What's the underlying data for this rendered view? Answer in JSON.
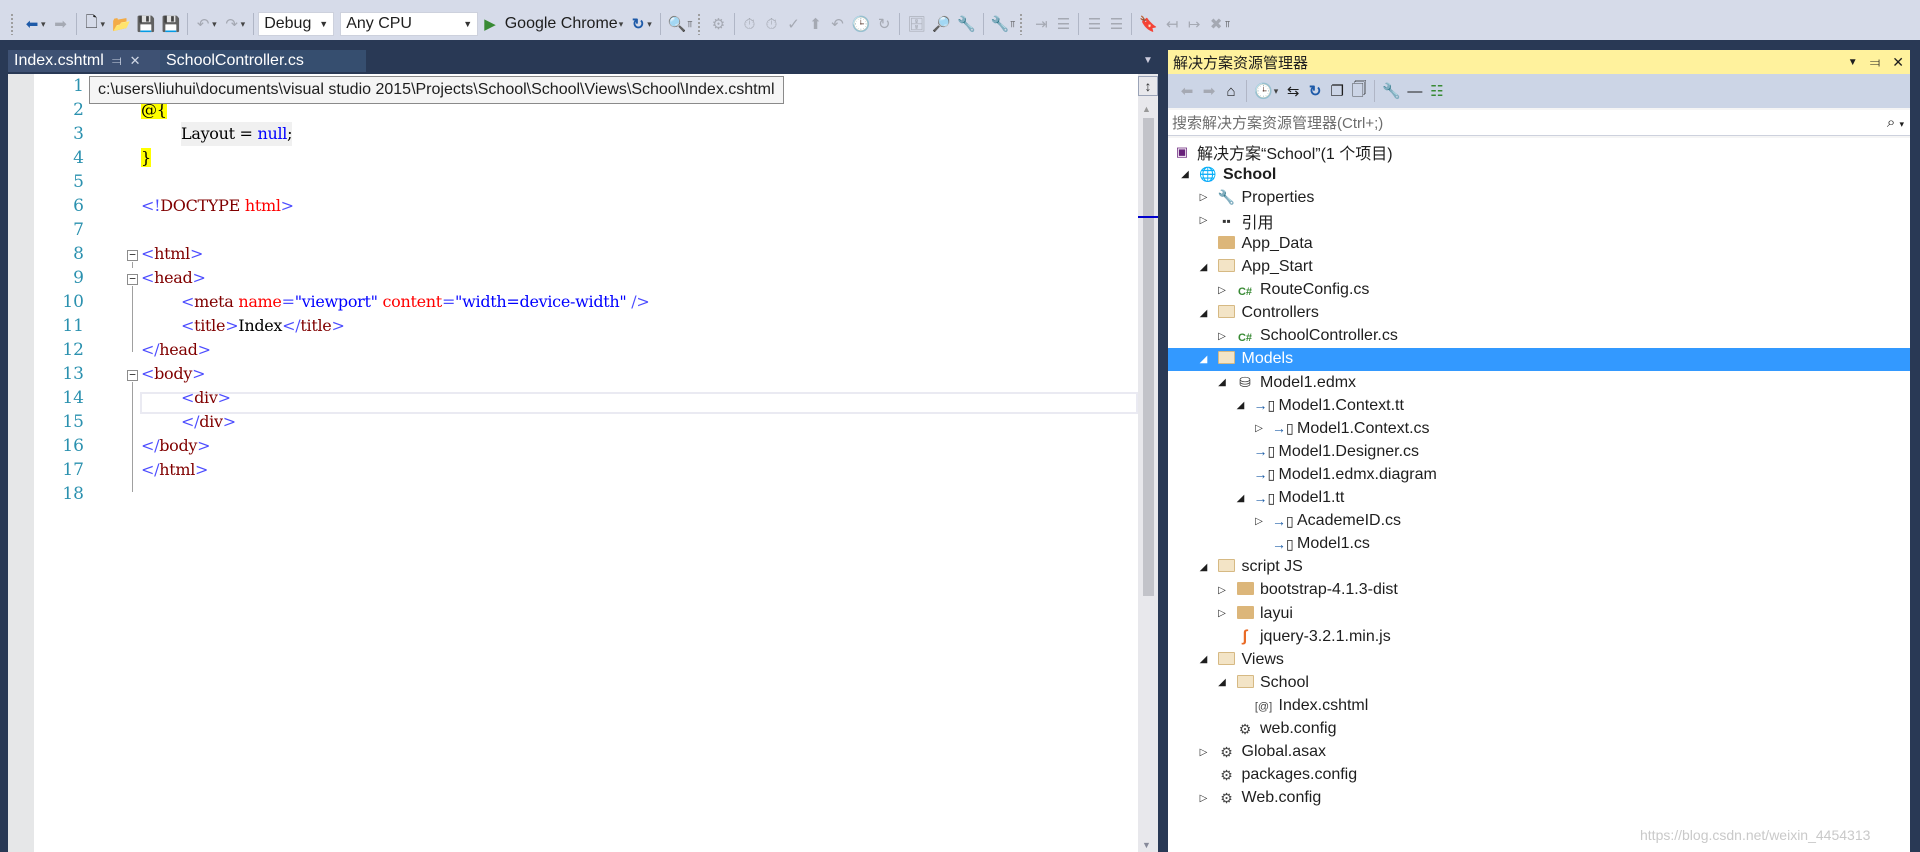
{
  "toolbar": {
    "configuration": "Debug",
    "platform": "Any CPU",
    "run_target": "Google Chrome",
    "icons": [
      "back-icon",
      "forward-icon",
      "new-project-icon",
      "open-file-icon",
      "save-icon",
      "save-all-icon",
      "undo-icon",
      "redo-icon",
      "refresh-icon",
      "find-in-files-icon",
      "bookmark-icon",
      "prev-bookmark-icon",
      "next-bookmark-icon",
      "clear-bookmarks-icon"
    ]
  },
  "tabs": [
    {
      "label": "Index.cshtml",
      "active": true
    },
    {
      "label": "SchoolController.cs",
      "active": false
    }
  ],
  "editor": {
    "tooltip_path": "c:\\users\\liuhui\\documents\\visual studio 2015\\Projects\\School\\School\\Views\\School\\Index.cshtml",
    "line_numbers": [
      "1",
      "2",
      "3",
      "4",
      "5",
      "6",
      "7",
      "8",
      "9",
      "10",
      "11",
      "12",
      "13",
      "14",
      "15",
      "16",
      "17",
      "18"
    ],
    "code": {
      "l2_at": "@{",
      "l3_layout": "Layout = ",
      "l3_null": "null",
      "l3_semi": ";",
      "l4_close": "}",
      "l6_lt": "<!",
      "l6_doctype": "DOCTYPE",
      "l6_html": " html",
      "l6_gt": ">",
      "html_tag": "html",
      "head_tag": "head",
      "meta_tag": "meta",
      "name_attr": " name",
      "eq": "=",
      "viewport_val": "\"viewport\"",
      "content_attr": " content",
      "content_val": "\"width=device-width\"",
      "self_close": " />",
      "title_tag": "title",
      "title_text": "Index",
      "body_tag": "body",
      "div_tag": "div",
      "lt": "<",
      "lt_slash": "</",
      "gt": ">"
    }
  },
  "solution_explorer": {
    "title": "解决方案资源管理器",
    "search_placeholder": "搜索解决方案资源管理器(Ctrl+;)",
    "tree": [
      {
        "label": "解决方案“School”(1 个项目)",
        "depth": 0,
        "expander": "",
        "icon": "solution-icon"
      },
      {
        "label": "School",
        "depth": 0,
        "expander": "expanded",
        "icon": "web-project-icon",
        "bold": true
      },
      {
        "label": "Properties",
        "depth": 1,
        "expander": "collapsed",
        "icon": "wrench-icon"
      },
      {
        "label": "引用",
        "depth": 1,
        "expander": "collapsed",
        "icon": "references-icon"
      },
      {
        "label": "App_Data",
        "depth": 1,
        "expander": "",
        "icon": "folder-icon"
      },
      {
        "label": "App_Start",
        "depth": 1,
        "expander": "expanded",
        "icon": "folder-open-icon"
      },
      {
        "label": "RouteConfig.cs",
        "depth": 2,
        "expander": "collapsed",
        "icon": "csharp-file-icon"
      },
      {
        "label": "Controllers",
        "depth": 1,
        "expander": "expanded",
        "icon": "folder-open-icon"
      },
      {
        "label": "SchoolController.cs",
        "depth": 2,
        "expander": "collapsed",
        "icon": "csharp-file-icon"
      },
      {
        "label": "Models",
        "depth": 1,
        "expander": "expanded",
        "icon": "folder-open-icon",
        "selected": true
      },
      {
        "label": "Model1.edmx",
        "depth": 2,
        "expander": "expanded",
        "icon": "edmx-icon"
      },
      {
        "label": "Model1.Context.tt",
        "depth": 3,
        "expander": "expanded",
        "icon": "template-file-icon"
      },
      {
        "label": "Model1.Context.cs",
        "depth": 4,
        "expander": "collapsed",
        "icon": "template-file-icon"
      },
      {
        "label": "Model1.Designer.cs",
        "depth": 3,
        "expander": "",
        "icon": "template-file-icon"
      },
      {
        "label": "Model1.edmx.diagram",
        "depth": 3,
        "expander": "",
        "icon": "template-file-icon"
      },
      {
        "label": "Model1.tt",
        "depth": 3,
        "expander": "expanded",
        "icon": "template-file-icon"
      },
      {
        "label": "AcademeID.cs",
        "depth": 4,
        "expander": "collapsed",
        "icon": "template-file-icon"
      },
      {
        "label": "Model1.cs",
        "depth": 4,
        "expander": "",
        "icon": "template-file-icon"
      },
      {
        "label": "script JS",
        "depth": 1,
        "expander": "expanded",
        "icon": "folder-open-icon"
      },
      {
        "label": "bootstrap-4.1.3-dist",
        "depth": 2,
        "expander": "collapsed",
        "icon": "folder-icon"
      },
      {
        "label": "layui",
        "depth": 2,
        "expander": "collapsed",
        "icon": "folder-icon"
      },
      {
        "label": "jquery-3.2.1.min.js",
        "depth": 2,
        "expander": "",
        "icon": "js-file-icon"
      },
      {
        "label": "Views",
        "depth": 1,
        "expander": "expanded",
        "icon": "folder-open-icon"
      },
      {
        "label": "School",
        "depth": 2,
        "expander": "expanded",
        "icon": "folder-open-icon"
      },
      {
        "label": "Index.cshtml",
        "depth": 3,
        "expander": "",
        "icon": "razor-file-icon"
      },
      {
        "label": "web.config",
        "depth": 2,
        "expander": "",
        "icon": "config-file-icon"
      },
      {
        "label": "Global.asax",
        "depth": 1,
        "expander": "collapsed",
        "icon": "asax-file-icon"
      },
      {
        "label": "packages.config",
        "depth": 1,
        "expander": "",
        "icon": "config-file-icon"
      },
      {
        "label": "Web.config",
        "depth": 1,
        "expander": "collapsed",
        "icon": "config-file-icon"
      }
    ]
  },
  "watermark": "https://blog.csdn.net/weixin_4454313",
  "colors": {
    "accent_selection": "#3399ff",
    "panel_header": "#fff29d",
    "chrome_dark": "#293955",
    "line_number": "#2b91af"
  }
}
